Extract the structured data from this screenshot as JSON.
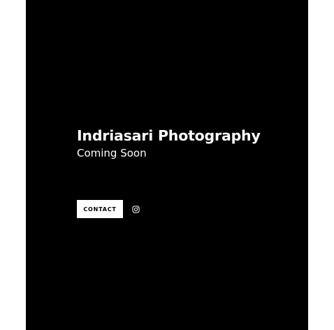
{
  "site": {
    "title": "Indriasari Photography",
    "subtitle": "Coming Soon"
  },
  "actions": {
    "contact_label": "CONTACT",
    "social_icon": "instagram-icon"
  },
  "colors": {
    "background": "#000000",
    "text": "#ffffff",
    "button_background": "#ffffff",
    "button_text": "#000000"
  }
}
